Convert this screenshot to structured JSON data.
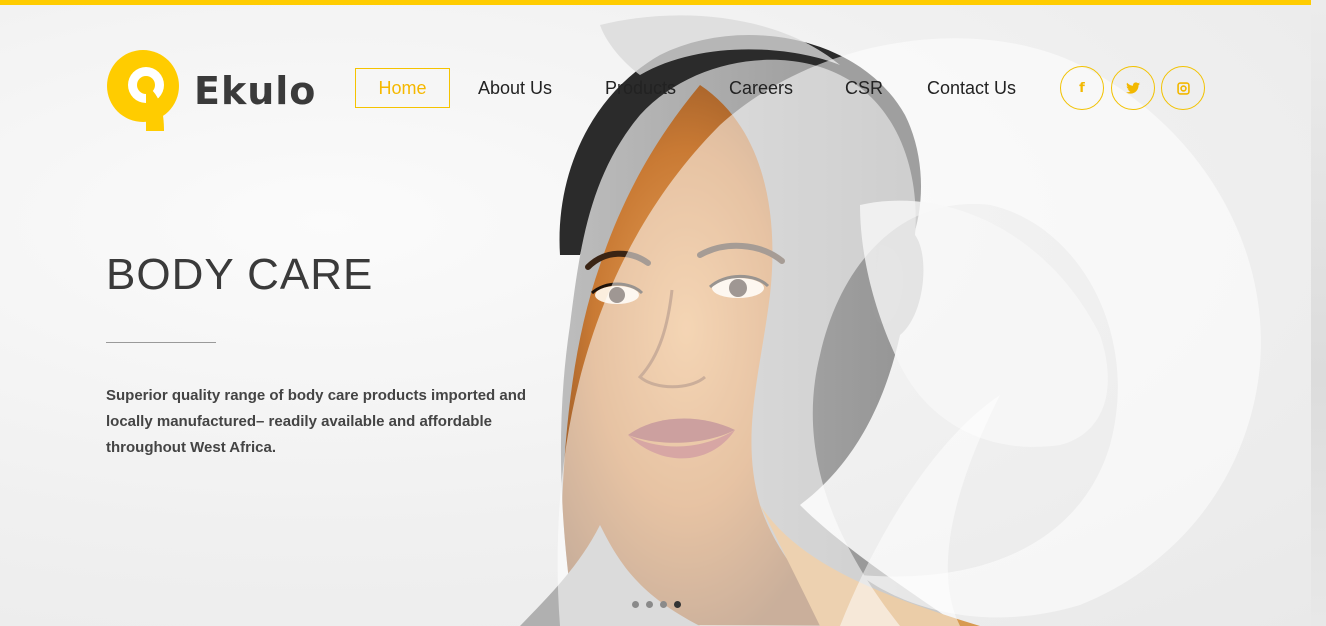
{
  "brand": {
    "name": "Ekulo",
    "accent": "#ffcc00"
  },
  "nav": {
    "items": [
      {
        "label": "Home",
        "active": true
      },
      {
        "label": "About Us",
        "active": false
      },
      {
        "label": "Products",
        "active": false
      },
      {
        "label": "Careers",
        "active": false
      },
      {
        "label": "CSR",
        "active": false
      },
      {
        "label": "Contact Us",
        "active": false
      }
    ]
  },
  "social": [
    {
      "icon": "facebook-icon",
      "glyph": "f"
    },
    {
      "icon": "twitter-icon",
      "glyph": "❧"
    },
    {
      "icon": "instagram-icon",
      "glyph": "▣"
    }
  ],
  "hero": {
    "title": "BODY CARE",
    "description": "Superior quality range of body care products imported and locally manufactured– readily available and affordable throughout West Africa."
  },
  "slider": {
    "count": 4,
    "active_index": 3
  }
}
